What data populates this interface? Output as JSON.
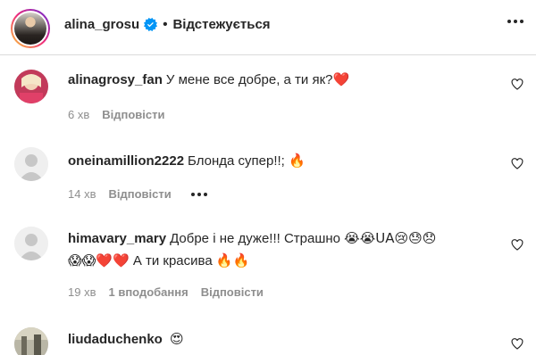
{
  "header": {
    "username": "alina_grosu",
    "separator": "•",
    "follow_status": "Відстежується"
  },
  "comments": [
    {
      "username": "alinagrosy_fan",
      "text": "У мене все добре, а ти як?",
      "emoji": "❤️",
      "time": "6 хв",
      "reply_label": "Відповісти"
    },
    {
      "username": "oneinamillion2222",
      "text": "Блонда супер!!;",
      "emoji": "🔥",
      "time": "14 хв",
      "reply_label": "Відповісти"
    },
    {
      "username": "himavary_mary",
      "text": "Добре і не дуже!!! Страшно",
      "emoji_line1": "😭😭UA😢😓😞",
      "emoji_line2a": "😱😱❤️❤️",
      "text_line2": "А ти красива",
      "emoji_line2b": "🔥🔥",
      "time": "19 хв",
      "likes": "1 вподобання",
      "reply_label": "Відповісти"
    },
    {
      "username": "liudaduchenko",
      "emoji": "😍"
    }
  ],
  "icons": {
    "verified": "verified-badge-icon",
    "more": "more-options-icon",
    "like": "heart-outline-icon"
  },
  "colors": {
    "text": "#262626",
    "secondary": "#8e8e8e",
    "verified_blue": "#0095f6",
    "divider": "#dbdbdb"
  }
}
